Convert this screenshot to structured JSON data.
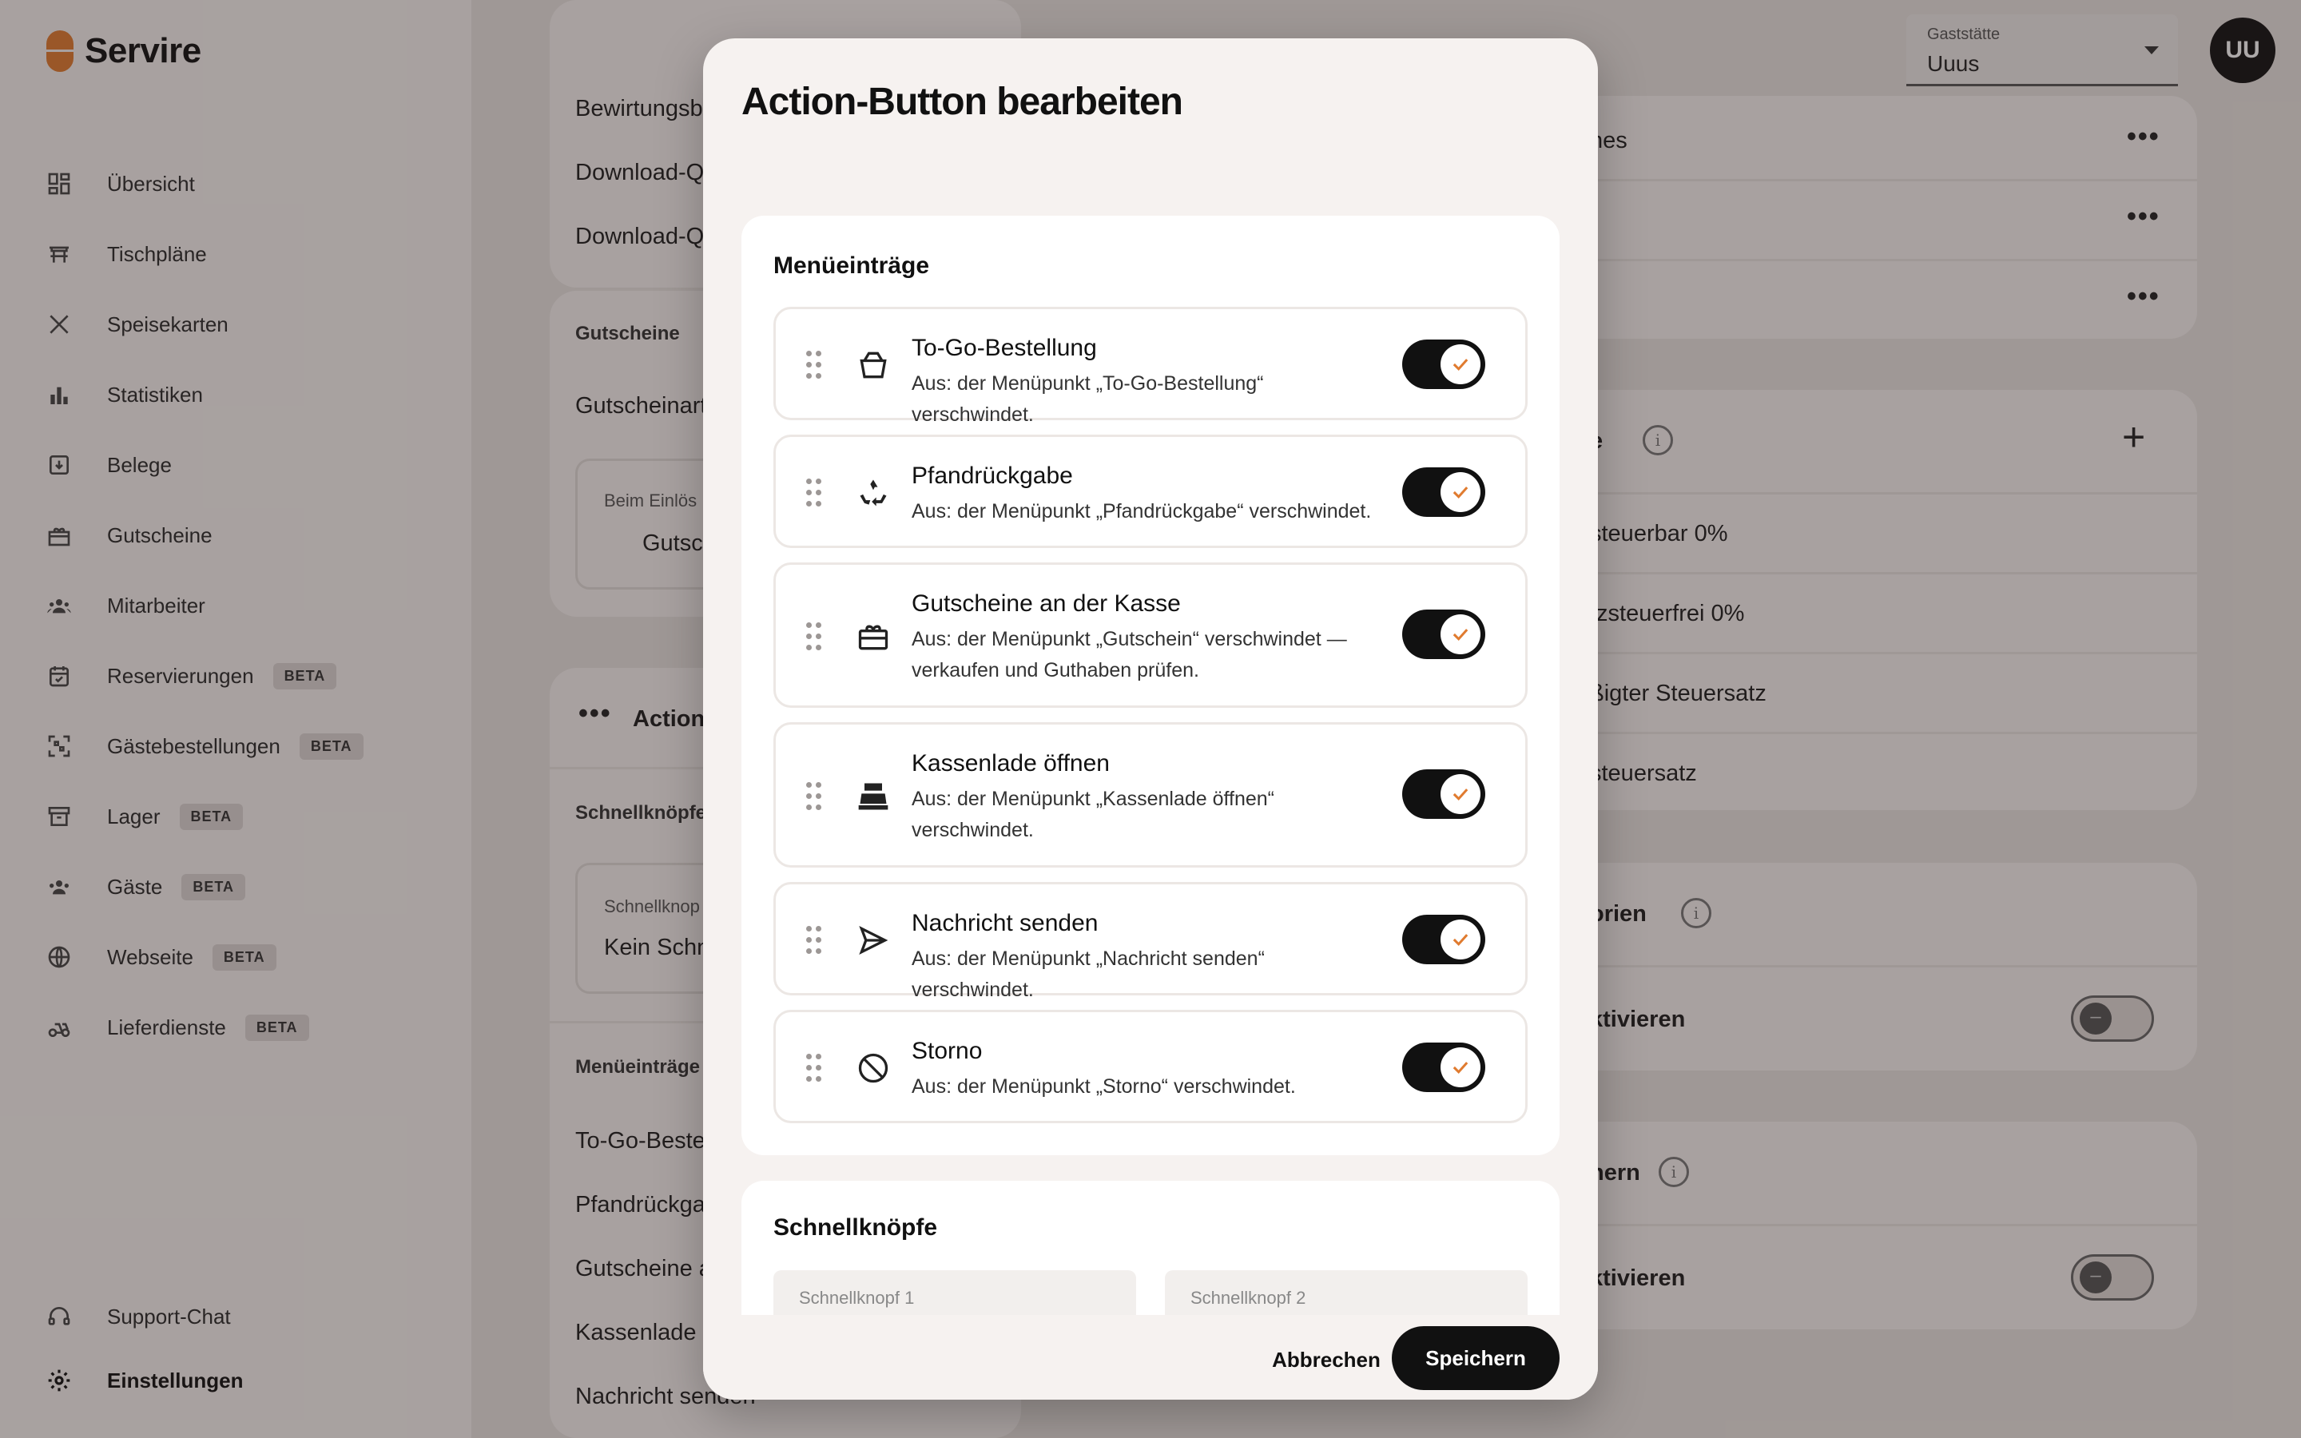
{
  "app": {
    "name": "Servire"
  },
  "sidebar": {
    "items": [
      {
        "label": "Übersicht",
        "icon": "dashboard-icon"
      },
      {
        "label": "Tischpläne",
        "icon": "table-icon"
      },
      {
        "label": "Speisekarten",
        "icon": "cutlery-icon"
      },
      {
        "label": "Statistiken",
        "icon": "bar-chart-icon"
      },
      {
        "label": "Belege",
        "icon": "receipt-icon"
      },
      {
        "label": "Gutscheine",
        "icon": "gift-icon"
      },
      {
        "label": "Mitarbeiter",
        "icon": "people-icon"
      },
      {
        "label": "Reservierungen",
        "icon": "calendar-check-icon",
        "badge": "BETA"
      },
      {
        "label": "Gästebestellungen",
        "icon": "qr-icon",
        "badge": "BETA"
      },
      {
        "label": "Lager",
        "icon": "archive-icon",
        "badge": "BETA"
      },
      {
        "label": "Gäste",
        "icon": "guests-icon",
        "badge": "BETA"
      },
      {
        "label": "Webseite",
        "icon": "globe-icon",
        "badge": "BETA"
      },
      {
        "label": "Lieferdienste",
        "icon": "scooter-icon",
        "badge": "BETA"
      }
    ],
    "bottom": [
      {
        "label": "Support-Chat",
        "icon": "headset-icon"
      },
      {
        "label": "Einstellungen",
        "icon": "gear-icon"
      }
    ]
  },
  "header": {
    "gaststaette_label": "Gaststätte",
    "gaststaette_value": "Uuus",
    "avatar": "UU"
  },
  "background": {
    "left": {
      "row1": "Bewirtungsb",
      "row2": "Download-QF",
      "row3": "Download-QF",
      "gutscheine_title": "Gutscheine",
      "gutscheinart": "Gutscheinart",
      "beim_einloesen": "Beim Einlös",
      "gutsch": "Gutsch",
      "action_title": "Action-",
      "schnellknoepfe_title": "Schnellknöpfe",
      "schnellknopf_label": "Schnellknop",
      "kein_schn": "Kein Schn",
      "menue_title": "Menüeinträge",
      "m1": "To-Go-Bestel",
      "m2": "Pfandrückga",
      "m3": "Gutscheine a",
      "m4": "Kassenlade ö",
      "m5": "Nachricht senden"
    },
    "right": {
      "r1": "nes",
      "tax_title": "e",
      "t1": "steuerbar 0%",
      "t2": "tzsteuerfrei 0%",
      "t3": "ßigter Steuersatz",
      "t4": "steuersatz",
      "kategorien": "orien",
      "aktivieren1": "ktivieren",
      "nern": "nern",
      "aktivieren2": "ktivieren"
    }
  },
  "modal": {
    "title": "Action-Button bearbeiten",
    "menu_section_title": "Menüeinträge",
    "items": [
      {
        "title": "To-Go-Bestellung",
        "desc": "Aus: der Menüpunkt „To-Go-Bestellung“ verschwindet.",
        "icon": "takeaway-box-icon",
        "enabled": true
      },
      {
        "title": "Pfandrückgabe",
        "desc": "Aus: der Menüpunkt „Pfandrückgabe“ verschwindet.",
        "icon": "recycle-icon",
        "enabled": true
      },
      {
        "title": "Gutscheine an der Kasse",
        "desc": "Aus: der Menüpunkt „Gutschein“ verschwindet — verkaufen und Guthaben prüfen.",
        "icon": "gift-card-icon",
        "enabled": true
      },
      {
        "title": "Kassenlade öffnen",
        "desc": "Aus: der Menüpunkt „Kassenlade öffnen“ verschwindet.",
        "icon": "cash-register-icon",
        "enabled": true
      },
      {
        "title": "Nachricht senden",
        "desc": "Aus: der Menüpunkt „Nachricht senden“ verschwindet.",
        "icon": "send-icon",
        "enabled": true
      },
      {
        "title": "Storno",
        "desc": "Aus: der Menüpunkt „Storno“ verschwindet.",
        "icon": "cancel-circle-icon",
        "enabled": true
      }
    ],
    "quick_section_title": "Schnellknöpfe",
    "quick1_label": "Schnellknopf 1",
    "quick2_label": "Schnellknopf 2",
    "cancel_label": "Abbrechen",
    "save_label": "Speichern"
  },
  "colors": {
    "accent": "#e07b2f",
    "toggle_on": "#111111"
  }
}
